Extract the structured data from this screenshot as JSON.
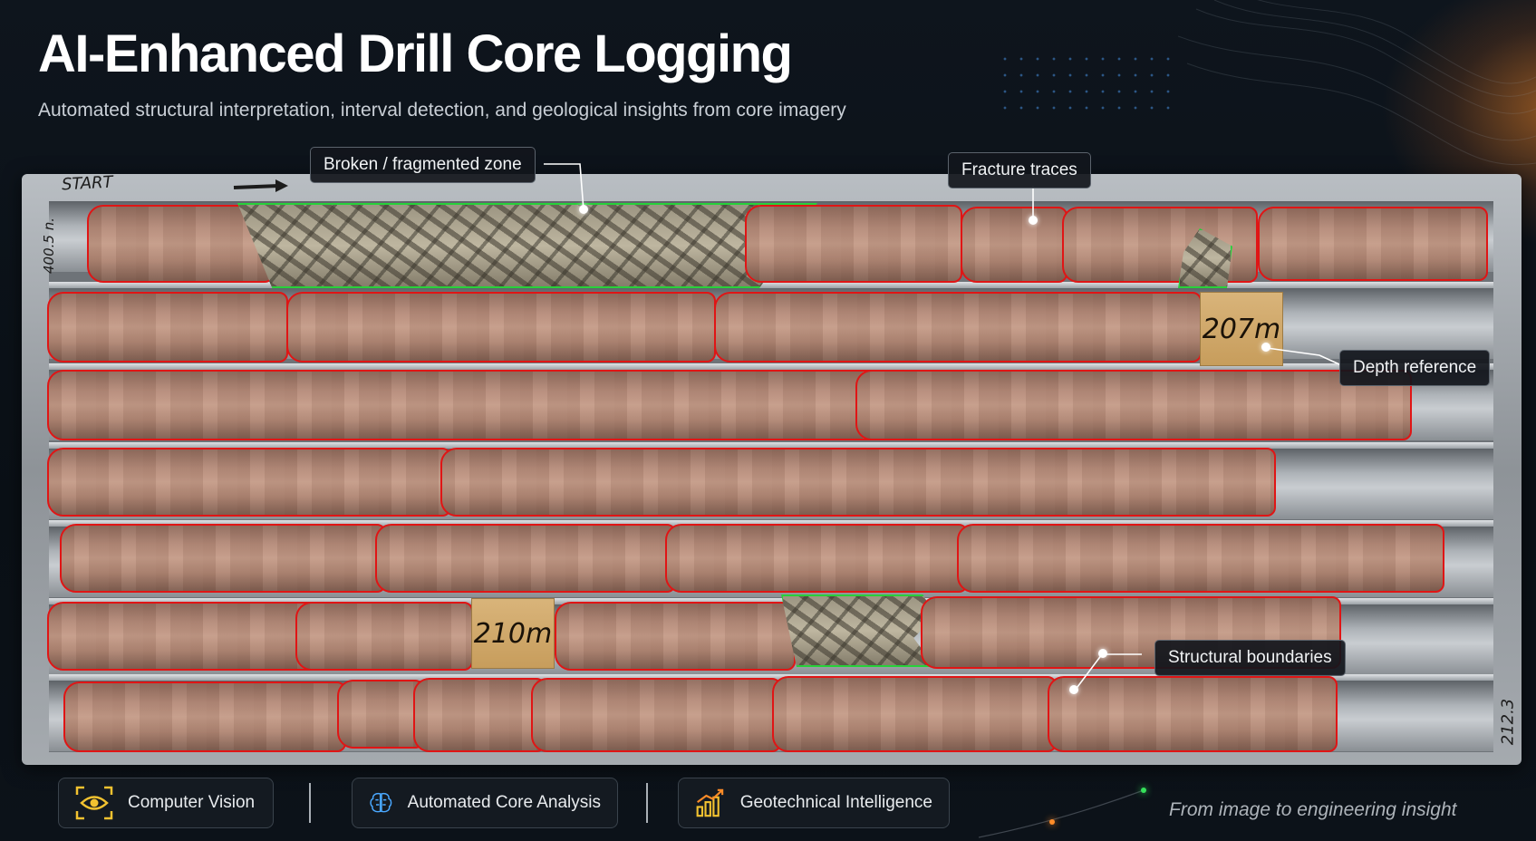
{
  "header": {
    "title": "AI-Enhanced Drill Core Logging",
    "subtitle": "Automated structural interpretation, interval detection, and geological insights from core imagery"
  },
  "tray": {
    "start_label": "START",
    "left_marker": "400.5 n.",
    "right_marker": "212.3",
    "depth_blocks": [
      "207m",
      "210m"
    ]
  },
  "annotations": {
    "broken_zone": "Broken / fragmented zone",
    "fracture_traces": "Fracture traces",
    "depth_reference": "Depth reference",
    "structural_boundaries": "Structural boundaries"
  },
  "footer": {
    "features": [
      {
        "label": "Computer Vision",
        "icon": "eye-scan-icon"
      },
      {
        "label": "Automated Core Analysis",
        "icon": "brain-icon"
      },
      {
        "label": "Geotechnical Intelligence",
        "icon": "bar-chart-icon"
      }
    ],
    "tagline": "From image to engineering insight"
  },
  "colors": {
    "boundary_outline": "#e01515",
    "fragment_outline": "#27d13a",
    "accent_orange": "#ff8c28",
    "icon_yellow": "#f2c230",
    "icon_blue": "#4aa8ff"
  }
}
